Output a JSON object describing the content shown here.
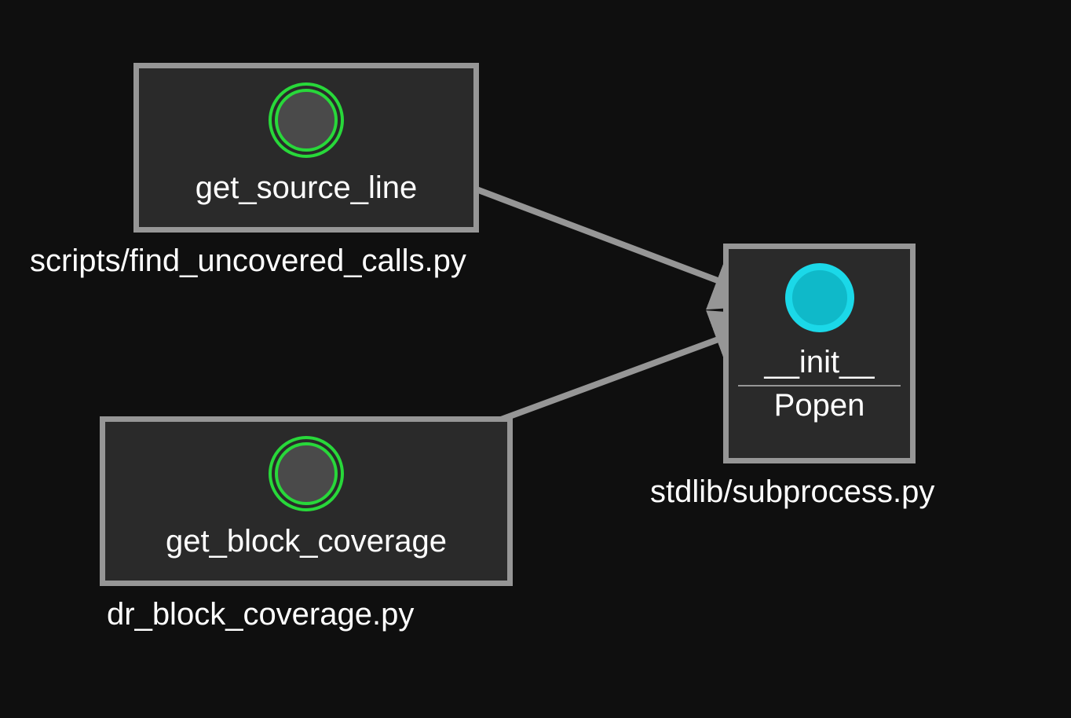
{
  "nodes": {
    "source_line": {
      "label": "get_source_line",
      "file": "scripts/find_uncovered_calls.py"
    },
    "block_coverage": {
      "label": "get_block_coverage",
      "file": "dr_block_coverage.py"
    },
    "init": {
      "label": "__init__",
      "class": "Popen",
      "file": "stdlib/subprocess.py"
    }
  },
  "edges": [
    {
      "from": "source_line",
      "to": "init"
    },
    {
      "from": "block_coverage",
      "to": "init"
    }
  ],
  "colors": {
    "background": "#0f0f0f",
    "box_bg": "#2a2a2a",
    "box_border": "#969696",
    "text": "#ffffff",
    "source_circle": "#28d83a",
    "target_circle_border": "#1bd8e8",
    "target_circle_fill": "#0fb9c9",
    "edge": "#969696"
  }
}
